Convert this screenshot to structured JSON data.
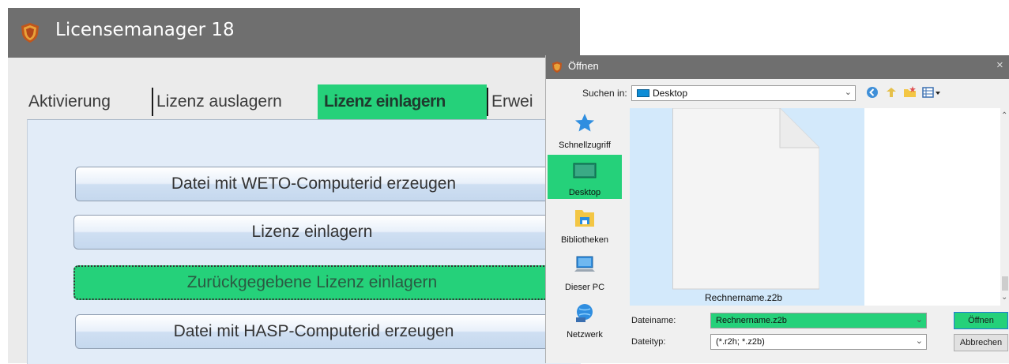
{
  "main_window": {
    "title": "Licensemanager 18",
    "tabs": [
      {
        "label": "Aktivierung"
      },
      {
        "label": "Lizenz auslagern"
      },
      {
        "label": "Lizenz einlagern",
        "active": true
      },
      {
        "label": "Erwei"
      }
    ],
    "buttons": [
      {
        "label": "Datei mit WETO-Computerid erzeugen"
      },
      {
        "label": "Lizenz einlagern"
      },
      {
        "label": "Zurückgegebene Lizenz einlagern",
        "highlighted": true
      },
      {
        "label": "Datei mit HASP-Computerid erzeugen"
      }
    ]
  },
  "open_dialog": {
    "title": "Öffnen",
    "close_glyph": "×",
    "look_in_label": "Suchen in:",
    "look_in_value": "Desktop",
    "places": [
      {
        "label": "Schnellzugriff",
        "icon": "star-pin-icon"
      },
      {
        "label": "Desktop",
        "icon": "desktop-icon",
        "active": true
      },
      {
        "label": "Bibliotheken",
        "icon": "library-folder-icon"
      },
      {
        "label": "Dieser PC",
        "icon": "computer-icon"
      },
      {
        "label": "Netzwerk",
        "icon": "network-icon"
      }
    ],
    "files": [
      {
        "name": "Rechnername.z2b",
        "selected": true
      }
    ],
    "filename_label": "Dateiname:",
    "filename_value": "Rechnername.z2b",
    "filetype_label": "Dateityp:",
    "filetype_value": "(*.r2h; *.z2b)",
    "open_button": "Öffnen",
    "cancel_button": "Abbrechen"
  },
  "colors": {
    "highlight": "#25d17a",
    "titlebar": "#6f6f6f",
    "panel": "#e2ecf8",
    "file_selection": "#d3e9fb"
  }
}
